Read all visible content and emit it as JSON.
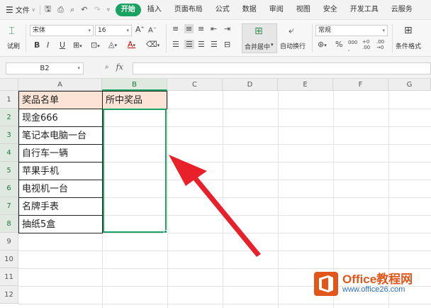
{
  "menubar": {
    "file_label": "文件",
    "tabs": [
      {
        "label": "开始",
        "active": true
      },
      {
        "label": "插入"
      },
      {
        "label": "页面布局"
      },
      {
        "label": "公式"
      },
      {
        "label": "数据"
      },
      {
        "label": "审阅"
      },
      {
        "label": "视图"
      },
      {
        "label": "安全"
      },
      {
        "label": "开发工具"
      },
      {
        "label": "云服务"
      }
    ],
    "accent_color": "#1aa260"
  },
  "ribbon": {
    "format_painter_label": "试刷",
    "font_name": "宋体",
    "font_size": "16",
    "merge_center_label": "合并居中",
    "wrap_text_label": "自动换行",
    "number_format": "常规",
    "percent_symbol": "%",
    "conditional_format_label": "条件格式"
  },
  "formula_bar": {
    "cell_ref": "B2",
    "fx_label": "fx",
    "formula_value": ""
  },
  "sheet": {
    "columns": [
      "A",
      "B",
      "C",
      "D",
      "E",
      "F",
      "G"
    ],
    "rows": [
      "1",
      "2",
      "3",
      "4",
      "5",
      "6",
      "7",
      "8",
      "9",
      "10",
      "11",
      "12"
    ],
    "selected_column": "B",
    "cells": {
      "A1": "奖品名单",
      "B1": "所中奖品",
      "A2": "现金666",
      "A3": "笔记本电脑一台",
      "A4": "自行车一辆",
      "A5": "苹果手机",
      "A6": "电视机一台",
      "A7": "名牌手表",
      "A8": "抽纸5盒"
    },
    "header_fill_color": "#fbe4d5"
  },
  "watermark": {
    "title": "Office教程网",
    "url": "www.office26.com"
  }
}
